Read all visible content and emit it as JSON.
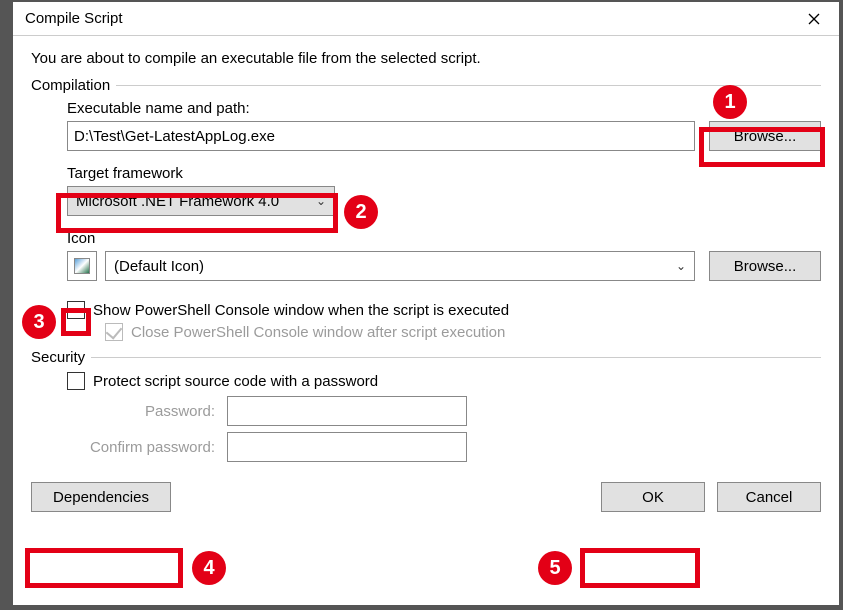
{
  "title": "Compile Script",
  "intro": "You are about to compile an executable file from the selected script.",
  "compilation": {
    "group_label": "Compilation",
    "exe_label": "Executable name and path:",
    "exe_value": "D:\\Test\\Get-LatestAppLog.exe",
    "browse_exe": "Browse...",
    "framework_label": "Target framework",
    "framework_value": "Microsoft .NET Framework 4.0",
    "icon_label": "Icon",
    "icon_value": "(Default Icon)",
    "browse_icon": "Browse...",
    "show_console": "Show PowerShell Console window when the script is executed",
    "close_console": "Close PowerShell Console window after script execution"
  },
  "security": {
    "group_label": "Security",
    "protect": "Protect script source code with a password",
    "password_label": "Password:",
    "confirm_label": "Confirm password:"
  },
  "footer": {
    "dependencies": "Dependencies",
    "ok": "OK",
    "cancel": "Cancel"
  },
  "annotations": {
    "n1": "1",
    "n2": "2",
    "n3": "3",
    "n4": "4",
    "n5": "5"
  }
}
